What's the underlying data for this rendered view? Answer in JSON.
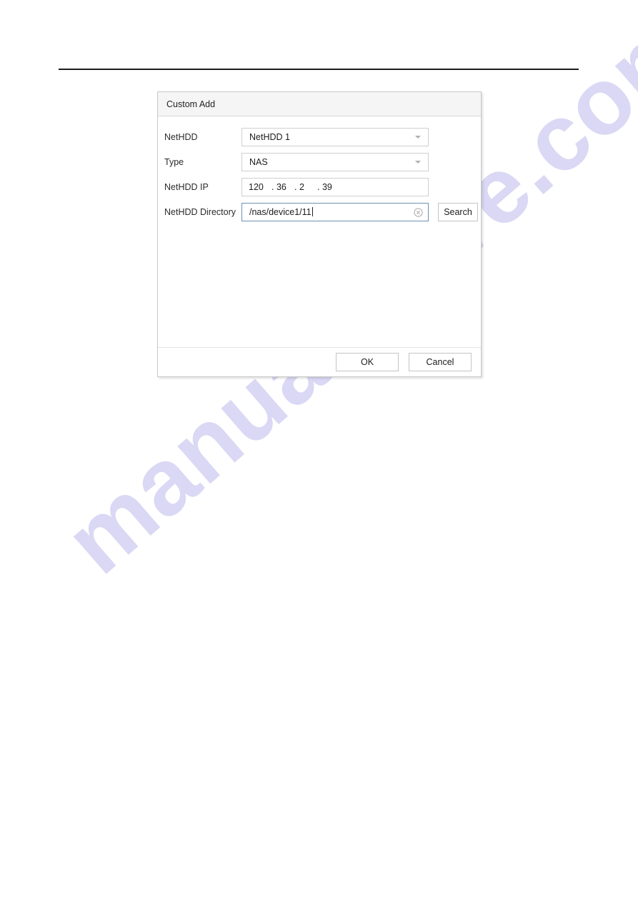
{
  "page": {
    "watermark": "manualshive.com"
  },
  "dialog": {
    "title": "Custom Add",
    "rows": [
      {
        "label": "NetHDD",
        "type": "select",
        "value": "NetHDD 1",
        "icon": "chevron-down-icon"
      },
      {
        "label": "Type",
        "type": "select",
        "value": "NAS",
        "icon": "chevron-down-icon"
      },
      {
        "label": "NetHDD IP",
        "type": "ip",
        "octets": [
          "120",
          "36",
          "2",
          "39"
        ],
        "separator": "."
      },
      {
        "label": "NetHDD Directory",
        "type": "text",
        "value": "/nas/device1/11",
        "clear_icon": "clear-circle-x-icon",
        "button_label": "Search"
      }
    ],
    "footer": {
      "ok_label": "OK",
      "cancel_label": "Cancel"
    }
  },
  "colors": {
    "header_bg": "#f5f5f5",
    "dialog_border": "#c8c8c8",
    "field_border": "#cfcfcf",
    "focus_border": "#6e8fb5",
    "watermark": "#cdcaf0",
    "rule": "#1d1d1d"
  }
}
